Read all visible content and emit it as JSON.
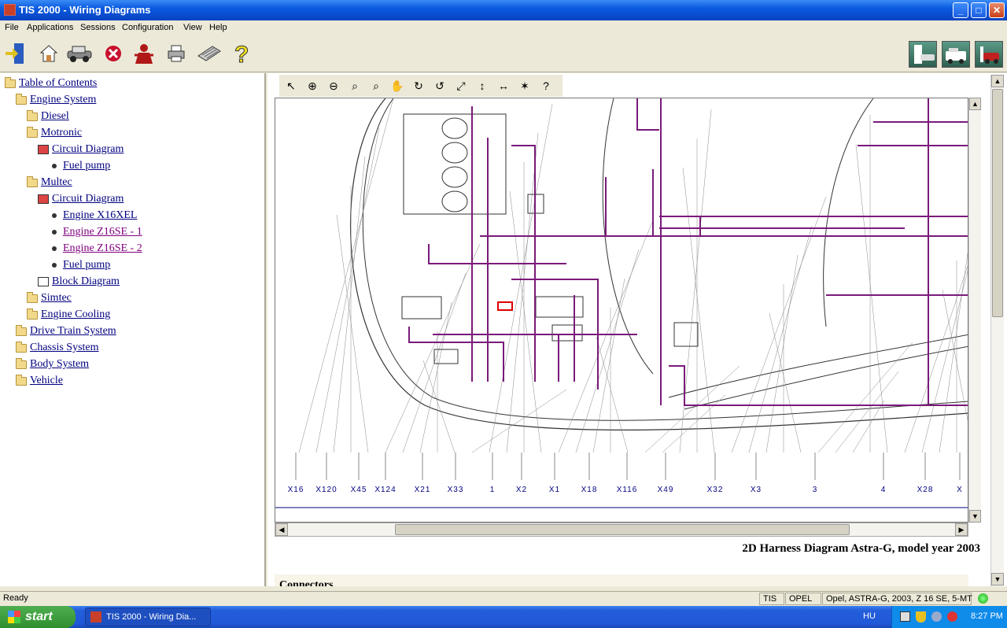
{
  "window": {
    "title": "TIS 2000 - Wiring Diagrams"
  },
  "menu": [
    "File",
    "Applications",
    "Sessions",
    "Configuration",
    "View",
    "Help"
  ],
  "toolbar": {
    "icons": [
      "exit-icon",
      "home-icon",
      "vehicle-icon",
      "stop-icon",
      "user-icon",
      "print-icon",
      "keyboard-icon",
      "help-icon"
    ],
    "right_icons": [
      "vehicle-select-icon",
      "ambulance-icon",
      "car-icon"
    ]
  },
  "tree": [
    {
      "label": "Table of Contents",
      "icon": "folder-open",
      "level": 0
    },
    {
      "label": "Engine System",
      "icon": "folder-open",
      "level": 1
    },
    {
      "label": "Diesel",
      "icon": "folder",
      "level": 2
    },
    {
      "label": "Motronic",
      "icon": "folder-open",
      "level": 2
    },
    {
      "label": "Circuit Diagram",
      "icon": "doc-red",
      "level": 3
    },
    {
      "label": "Fuel pump",
      "icon": "bullet",
      "level": 4
    },
    {
      "label": "Multec",
      "icon": "folder-open",
      "level": 2
    },
    {
      "label": "Circuit Diagram",
      "icon": "doc-red",
      "level": 3
    },
    {
      "label": "Engine X16XEL",
      "icon": "bullet",
      "level": 4
    },
    {
      "label": "Engine Z16SE - 1",
      "icon": "bullet",
      "level": 4,
      "visited": true
    },
    {
      "label": "Engine Z16SE - 2",
      "icon": "bullet",
      "level": 4,
      "visited": true
    },
    {
      "label": "Fuel pump",
      "icon": "bullet",
      "level": 4
    },
    {
      "label": "Block Diagram",
      "icon": "doc",
      "level": 3
    },
    {
      "label": "Simtec",
      "icon": "folder",
      "level": 2
    },
    {
      "label": "Engine Cooling",
      "icon": "folder",
      "level": 2
    },
    {
      "label": "Drive Train System",
      "icon": "folder",
      "level": 1
    },
    {
      "label": "Chassis System",
      "icon": "folder",
      "level": 1
    },
    {
      "label": "Body System",
      "icon": "folder",
      "level": 1
    },
    {
      "label": "Vehicle",
      "icon": "folder",
      "level": 1
    }
  ],
  "diagram_tools": [
    "select-icon",
    "zoom-in-icon",
    "zoom-out-icon",
    "zoom-icon",
    "zoom-window-icon",
    "pan-hand-icon",
    "rotate-cw-icon",
    "rotate-ccw-icon",
    "fit-page-icon",
    "fit-height-icon",
    "fit-width-icon",
    "highlight-icon",
    "help-icon"
  ],
  "connector_labels": [
    "X16",
    "X120",
    "X45",
    "X124",
    "X21",
    "X33",
    "1",
    "X2",
    "X1",
    "X18",
    "X116",
    "X49",
    "X32",
    "X3",
    "3",
    "4",
    "X28",
    "X"
  ],
  "diagram": {
    "caption": "2D Harness Diagram Astra-G, model year 2003",
    "section_heading": "Connectors",
    "wire_color": "#7a1a7a"
  },
  "status": {
    "text": "Ready",
    "panels": [
      "TIS",
      "OPEL",
      "Opel, ASTRA-G, 2003, Z 16 SE, 5-MT"
    ]
  },
  "taskbar": {
    "start_label": "start",
    "task_label": "TIS 2000 - Wiring Dia...",
    "language": "HU",
    "clock": "8:27 PM"
  }
}
